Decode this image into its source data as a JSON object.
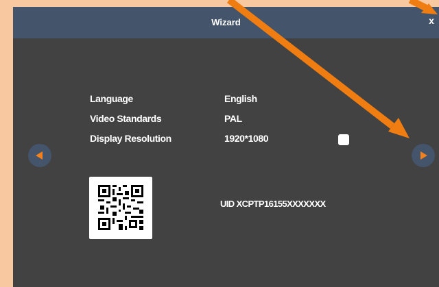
{
  "window": {
    "title": "Wizard",
    "close_label": "x"
  },
  "settings": [
    {
      "label": "Language",
      "value": "English"
    },
    {
      "label": "Video Standards",
      "value": "PAL"
    },
    {
      "label": "Display Resolution",
      "value": "1920*1080"
    }
  ],
  "checkbox": {
    "checked": false
  },
  "device": {
    "uid_text": "UID XCPTP16155XXXXXXX"
  },
  "icons": {
    "prev": "left-triangle-icon",
    "next": "right-triangle-icon",
    "qr": "qr-code-icon"
  },
  "colors": {
    "page_background": "#f8c9a0",
    "dialog_background": "#424242",
    "titlebar": "#44546a",
    "accent": "#f0811e",
    "annotation_arrow": "#f07d12"
  }
}
